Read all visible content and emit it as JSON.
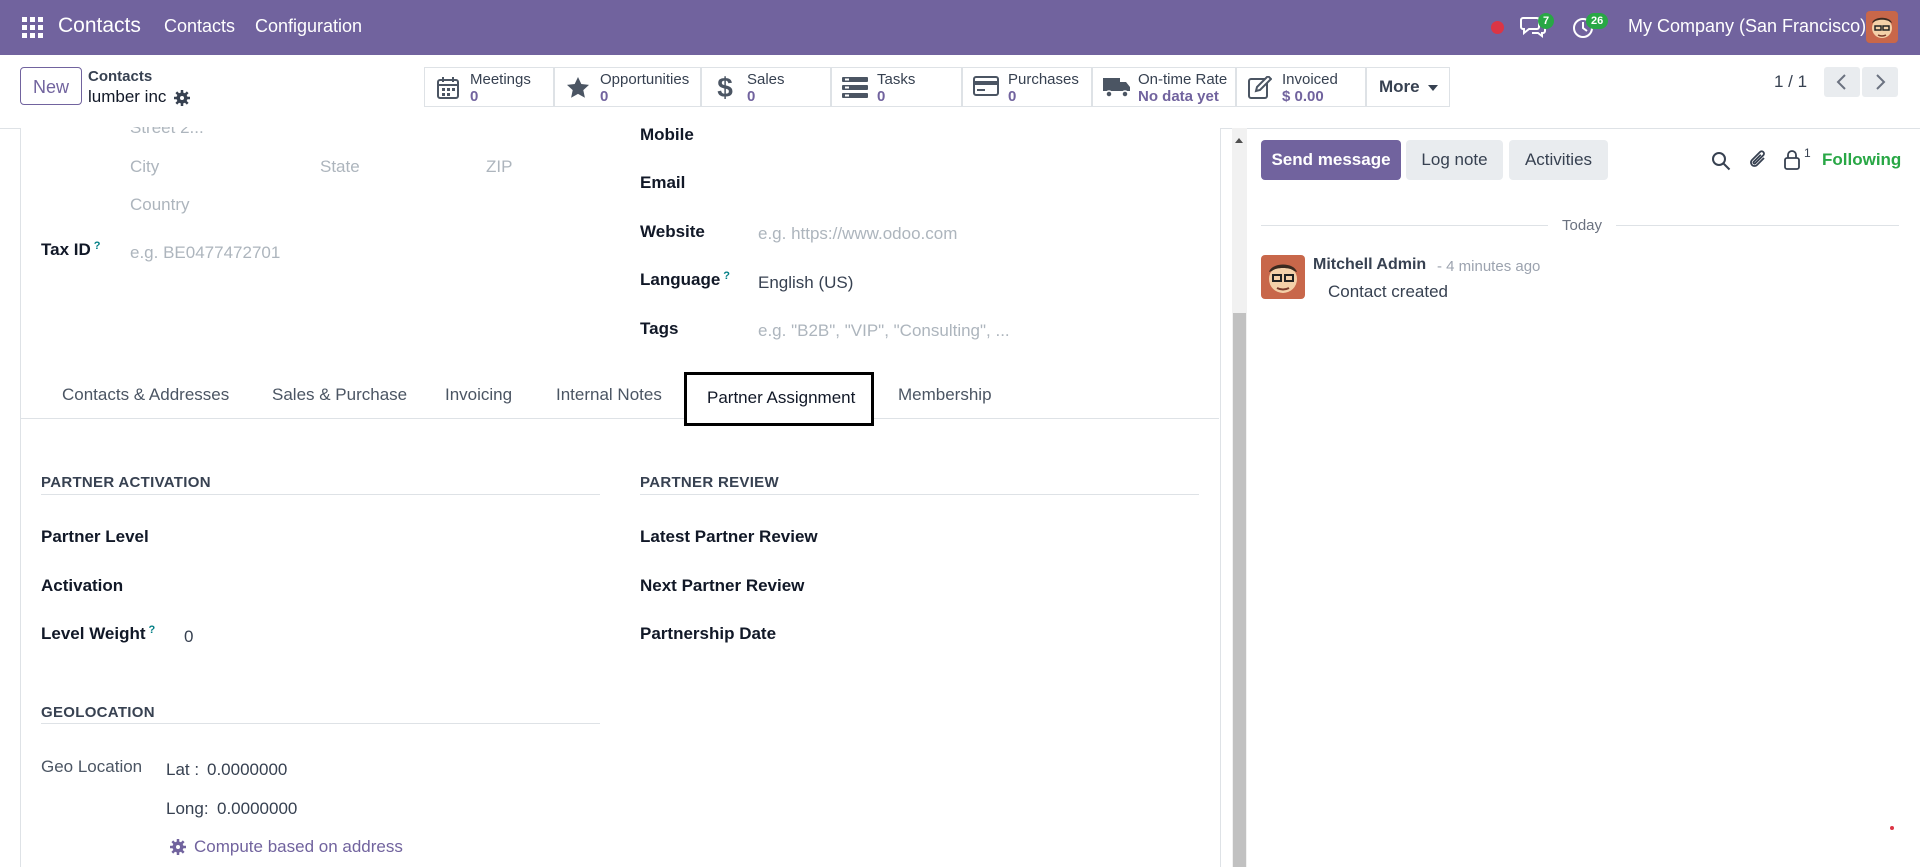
{
  "navbar": {
    "app_title": "Contacts",
    "menu": [
      "Contacts",
      "Configuration"
    ],
    "messages_count": "7",
    "activities_count": "26",
    "company": "My Company (San Francisco)"
  },
  "control": {
    "new_label": "New",
    "breadcrumb": "Contacts",
    "record_name": "lumber inc",
    "pager": "1 / 1",
    "smart_buttons": [
      {
        "label": "Meetings",
        "value": "0",
        "icon": "calendar-icon"
      },
      {
        "label": "Opportunities",
        "value": "0",
        "icon": "star-icon"
      },
      {
        "label": "Sales",
        "value": "0",
        "icon": "dollar-icon"
      },
      {
        "label": "Tasks",
        "value": "0",
        "icon": "tasks-icon"
      },
      {
        "label": "Purchases",
        "value": "0",
        "icon": "credit-card-icon"
      },
      {
        "label": "On-time Rate",
        "value": "No data yet",
        "icon": "truck-icon"
      },
      {
        "label": "Invoiced",
        "value": "$ 0.00",
        "icon": "invoice-icon"
      }
    ],
    "more_label": "More"
  },
  "form": {
    "street2_ph": "Street 2...",
    "city_ph": "City",
    "state_ph": "State",
    "zip_ph": "ZIP",
    "country_ph": "Country",
    "taxid_label": "Tax ID",
    "taxid_ph": "e.g. BE0477472701",
    "mobile_label": "Mobile",
    "email_label": "Email",
    "website_label": "Website",
    "website_ph": "e.g. https://www.odoo.com",
    "language_label": "Language",
    "language_value": "English (US)",
    "tags_label": "Tags",
    "tags_ph": "e.g. \"B2B\", \"VIP\", \"Consulting\", ...",
    "help_mark": "?"
  },
  "tabs": [
    "Contacts & Addresses",
    "Sales & Purchase",
    "Invoicing",
    "Internal Notes",
    "Partner Assignment",
    "Membership"
  ],
  "partner": {
    "activation_title": "PARTNER ACTIVATION",
    "partner_level": "Partner Level",
    "activation": "Activation",
    "level_weight": "Level Weight",
    "level_weight_value": "0",
    "review_title": "PARTNER REVIEW",
    "latest_review": "Latest Partner Review",
    "next_review": "Next Partner Review",
    "partnership_date": "Partnership Date",
    "geo_title": "GEOLOCATION",
    "geo_label": "Geo Location",
    "lat_label": "Lat :",
    "lat_value": "0.0000000",
    "long_label": "Long:",
    "long_value": "0.0000000",
    "compute_label": "Compute based on address"
  },
  "chatter": {
    "send_message": "Send message",
    "log_note": "Log note",
    "activities": "Activities",
    "followers_count": "1",
    "following": "Following",
    "date_separator": "Today",
    "author": "Mitchell Admin",
    "time": "- 4 minutes ago",
    "body": "Contact created"
  },
  "colors": {
    "brand": "#71639e",
    "green": "#28a745",
    "following": "#28a745"
  }
}
